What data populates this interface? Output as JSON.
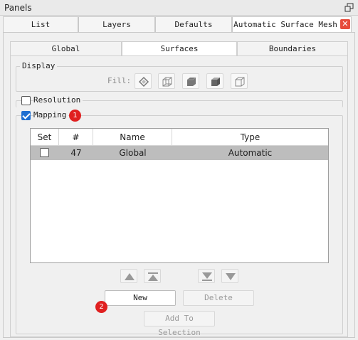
{
  "window": {
    "title": "Panels",
    "float_icon": "float-window-icon"
  },
  "outer_tabs": [
    {
      "label": "List"
    },
    {
      "label": "Layers"
    },
    {
      "label": "Defaults"
    },
    {
      "label": "Automatic Surface Mesh",
      "close_icon": "close-icon",
      "close_glyph": "✕"
    }
  ],
  "inner_tabs": [
    {
      "label": "Global"
    },
    {
      "label": "Surfaces"
    },
    {
      "label": "Boundaries"
    }
  ],
  "display_group": {
    "legend": "Display",
    "fill_label": "Fill:",
    "fill_icons": [
      "fill-outline-diamond-icon",
      "fill-wireframe-cube-icon",
      "fill-solid-cube-icon",
      "fill-shaded-cube-icon",
      "fill-outline-cube-icon"
    ]
  },
  "resolution": {
    "label": "Resolution",
    "checked": false
  },
  "mapping": {
    "label": "Mapping",
    "checked": true,
    "badge": "1"
  },
  "table": {
    "columns": [
      "Set",
      "#",
      "Name",
      "Type"
    ],
    "rows": [
      {
        "set": false,
        "number": "47",
        "name": "Global",
        "type": "Automatic"
      }
    ]
  },
  "arrow_buttons": [
    "move-up-icon",
    "move-to-top-icon",
    "move-to-bottom-icon",
    "move-down-icon"
  ],
  "buttons": {
    "new_label": "New",
    "new_badge": "2",
    "delete_label": "Delete",
    "add_to_selection_label": "Add To Selection"
  }
}
